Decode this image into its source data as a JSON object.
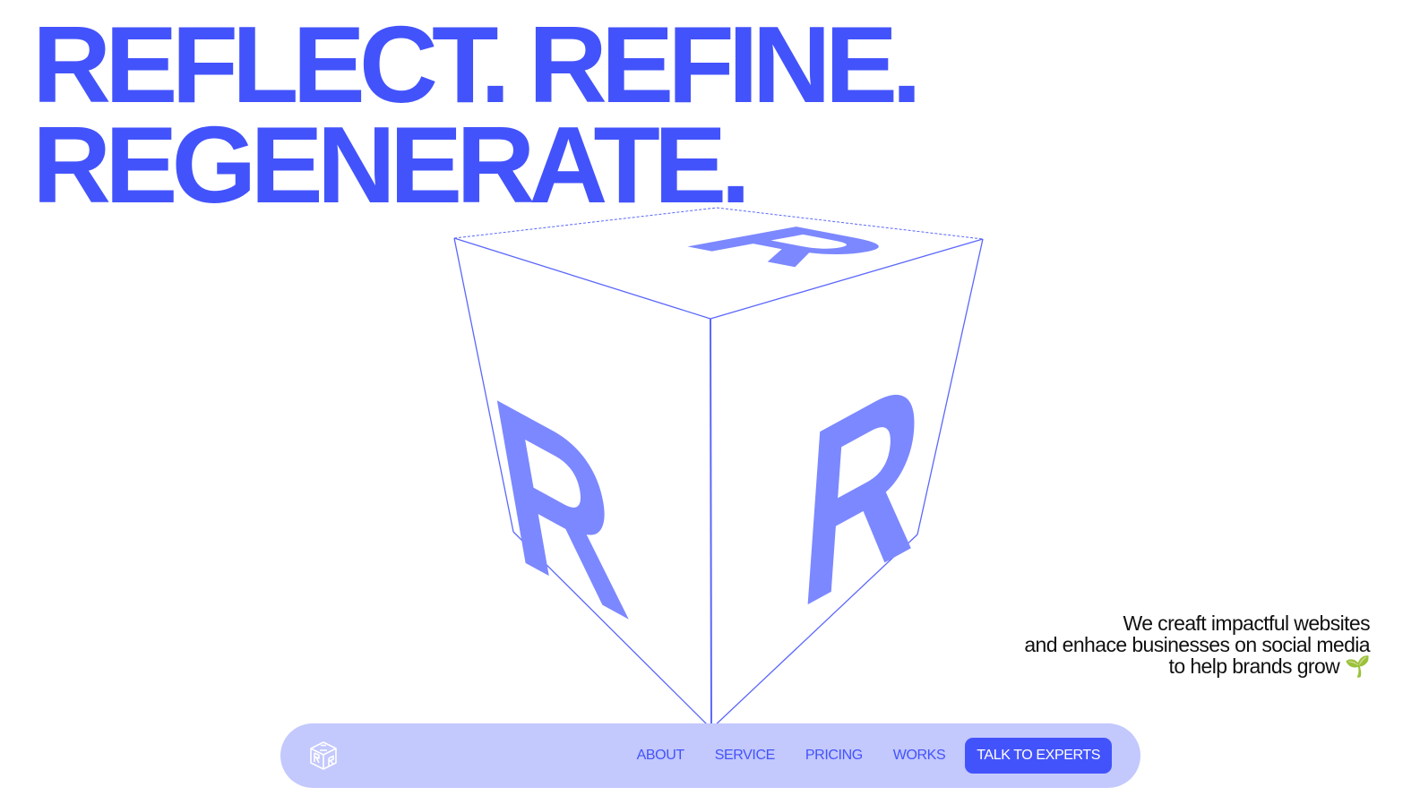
{
  "hero": {
    "line1": "REFLECT. REFINE.",
    "line2": "REGENERATE.",
    "tagline": [
      "We creaft impactful websites",
      "and enhace businesses on social media",
      "to help brands grow 🌱"
    ]
  },
  "cube": {
    "face_letter": "R"
  },
  "nav": {
    "logo_icon": "cube-logo-icon",
    "links": [
      "ABOUT",
      "SERVICE",
      "PRICING",
      "WORKS"
    ],
    "cta": "TALK TO EXPERTS"
  },
  "colors": {
    "accent": "#4353fb",
    "cube_letter": "#7c88ff",
    "nav_background": "#c3c8fd",
    "text": "#111111"
  }
}
